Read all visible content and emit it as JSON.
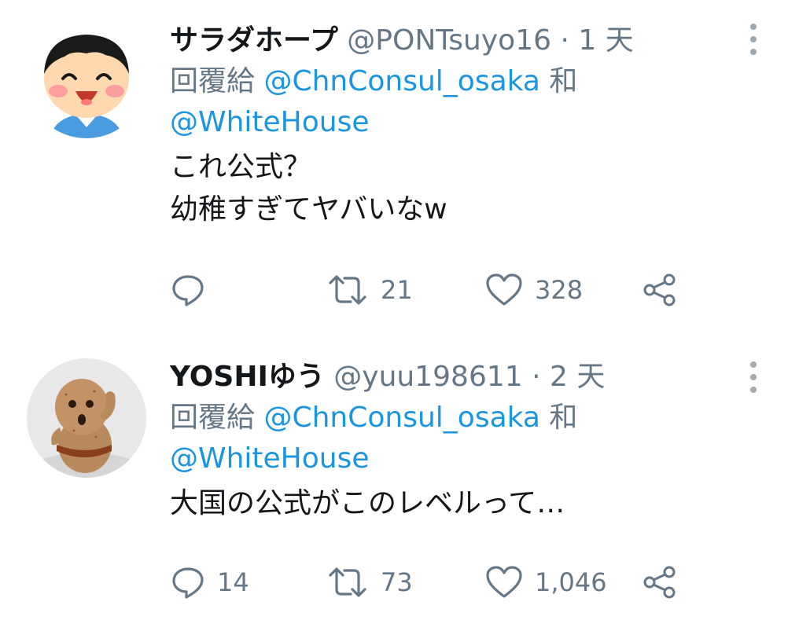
{
  "tweets": [
    {
      "display_name": "サラダホープ",
      "handle": "@PONTsuyo16",
      "separator": "·",
      "time": "1 天",
      "reply_prefix": "回覆給",
      "reply_mention_1": "@ChnConsul_osaka",
      "reply_conjunction": "和",
      "reply_mention_2": "@WhiteHouse",
      "text_lines": [
        "これ公式？",
        "幼稚すぎてヤバいなw"
      ],
      "reply_count": "",
      "retweet_count": "21",
      "like_count": "328",
      "avatar_icon": "cartoon-boy-avatar"
    },
    {
      "display_name": "YOSHIゆう",
      "handle": "@yuu198611",
      "separator": "·",
      "time": "2 天",
      "reply_prefix": "回覆給",
      "reply_mention_1": "@ChnConsul_osaka",
      "reply_conjunction": "和",
      "reply_mention_2": "@WhiteHouse",
      "text_lines": [
        "大国の公式がこのレベルって…"
      ],
      "reply_count": "14",
      "retweet_count": "73",
      "like_count": "1,046",
      "avatar_icon": "clay-figure-avatar"
    }
  ],
  "icons": {
    "reply": "comment-bubble-icon",
    "retweet": "retweet-arrows-icon",
    "like": "heart-icon",
    "share": "share-nodes-icon",
    "more": "vertical-dots-menu-icon"
  },
  "colors": {
    "name": "#14171a",
    "secondary": "#657786",
    "mention": "#1b95e0",
    "icon": "#657786"
  }
}
